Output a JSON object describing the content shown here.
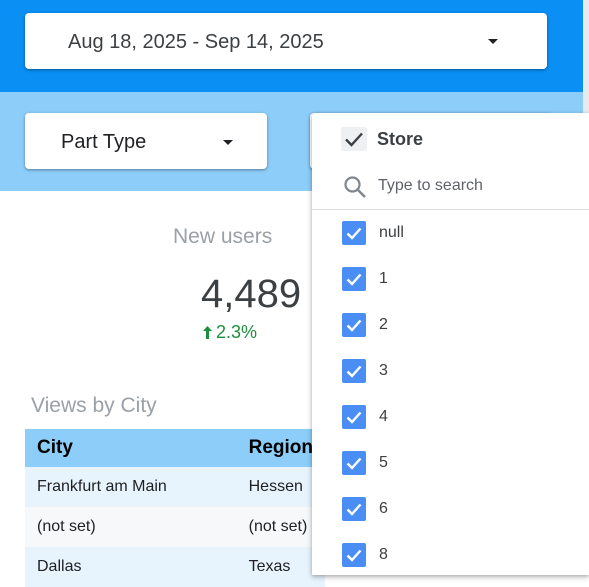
{
  "date_range": {
    "label": "Aug 18, 2025 - Sep 14, 2025"
  },
  "filters": {
    "part_type": "Part Type"
  },
  "kpi": {
    "title": "New users",
    "value": "4,489",
    "delta": "2.3%"
  },
  "table": {
    "title": "Views by City",
    "columns": [
      "City",
      "Region"
    ],
    "rows": [
      [
        "Frankfurt am Main",
        "Hessen"
      ],
      [
        "(not set)",
        "(not set)"
      ],
      [
        "Dallas",
        "Texas"
      ]
    ]
  },
  "store_dropdown": {
    "title": "Store",
    "search_placeholder": "Type to search",
    "options": [
      "null",
      "1",
      "2",
      "3",
      "4",
      "5",
      "6",
      "8"
    ]
  },
  "colors": {
    "header_blue": "#0a8ff4",
    "filter_band": "#8dcdf9",
    "checkbox_blue": "#4a8ef5",
    "positive_green": "#1e8e3e"
  }
}
